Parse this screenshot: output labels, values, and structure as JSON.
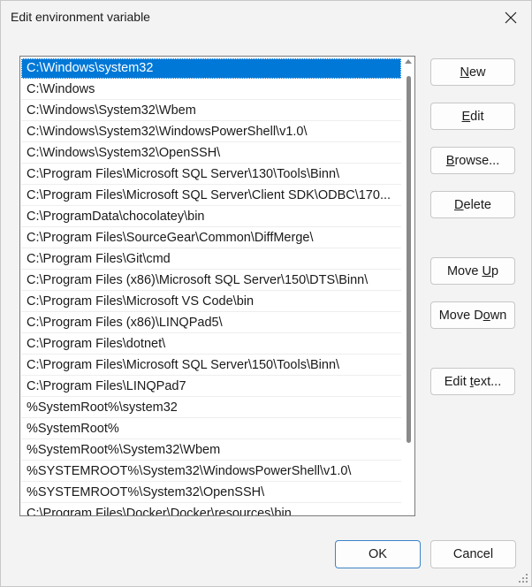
{
  "window": {
    "title": "Edit environment variable"
  },
  "path_list": {
    "selected_index": 0,
    "items": [
      "C:\\Windows\\system32",
      "C:\\Windows",
      "C:\\Windows\\System32\\Wbem",
      "C:\\Windows\\System32\\WindowsPowerShell\\v1.0\\",
      "C:\\Windows\\System32\\OpenSSH\\",
      "C:\\Program Files\\Microsoft SQL Server\\130\\Tools\\Binn\\",
      "C:\\Program Files\\Microsoft SQL Server\\Client SDK\\ODBC\\170...",
      "C:\\ProgramData\\chocolatey\\bin",
      "C:\\Program Files\\SourceGear\\Common\\DiffMerge\\",
      "C:\\Program Files\\Git\\cmd",
      "C:\\Program Files (x86)\\Microsoft SQL Server\\150\\DTS\\Binn\\",
      "C:\\Program Files\\Microsoft VS Code\\bin",
      "C:\\Program Files (x86)\\LINQPad5\\",
      "C:\\Program Files\\dotnet\\",
      "C:\\Program Files\\Microsoft SQL Server\\150\\Tools\\Binn\\",
      "C:\\Program Files\\LINQPad7",
      "%SystemRoot%\\system32",
      "%SystemRoot%",
      "%SystemRoot%\\System32\\Wbem",
      "%SYSTEMROOT%\\System32\\WindowsPowerShell\\v1.0\\",
      "%SYSTEMROOT%\\System32\\OpenSSH\\",
      "C:\\Program Files\\Docker\\Docker\\resources\\bin"
    ]
  },
  "buttons": {
    "new": {
      "pre": "",
      "key": "N",
      "post": "ew"
    },
    "edit": {
      "pre": "",
      "key": "E",
      "post": "dit"
    },
    "browse": {
      "pre": "",
      "key": "B",
      "post": "rowse..."
    },
    "delete": {
      "pre": "",
      "key": "D",
      "post": "elete"
    },
    "move_up": {
      "pre": "Move ",
      "key": "U",
      "post": "p"
    },
    "move_down": {
      "pre": "Move D",
      "key": "o",
      "post": "wn"
    },
    "edit_text": {
      "pre": "Edit ",
      "key": "t",
      "post": "ext..."
    },
    "ok": "OK",
    "cancel": "Cancel"
  },
  "colors": {
    "selection": "#0078d7",
    "accent_border": "#3b84c9"
  }
}
